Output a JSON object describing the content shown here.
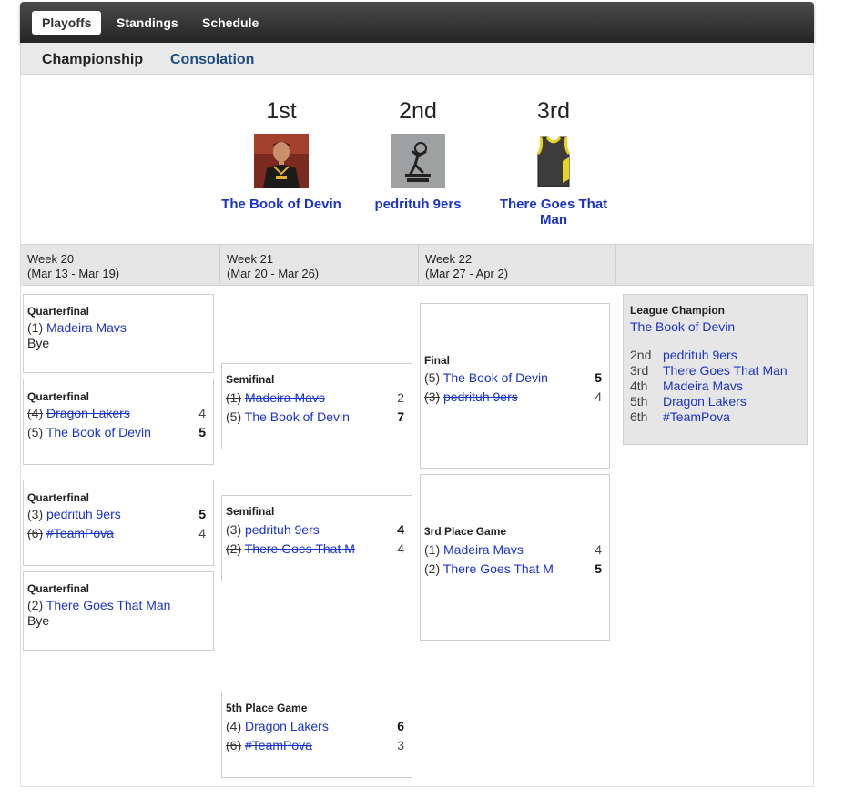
{
  "nav": {
    "tabs": [
      {
        "label": "Playoffs",
        "active": true
      },
      {
        "label": "Standings",
        "active": false
      },
      {
        "label": "Schedule",
        "active": false
      }
    ]
  },
  "subnav": {
    "championship": "Championship",
    "consolation": "Consolation"
  },
  "podium": [
    {
      "place": "1st",
      "team": "The Book of Devin",
      "team_line2": ""
    },
    {
      "place": "2nd",
      "team": "pedrituh 9ers",
      "team_line2": ""
    },
    {
      "place": "3rd",
      "team": "There Goes That",
      "team_line2": "Man"
    }
  ],
  "weeks": [
    {
      "label": "Week 20",
      "range": "(Mar 13 - Mar 19)"
    },
    {
      "label": "Week 21",
      "range": "(Mar 20 - Mar 26)"
    },
    {
      "label": "Week 22",
      "range": "(Mar 27 - Apr 2)"
    },
    {
      "label": "",
      "range": ""
    }
  ],
  "games": {
    "qf1": {
      "title": "Quarterfinal",
      "t1_seed": "(1)",
      "t1": "Madeira Mavs",
      "bye": "Bye"
    },
    "qf2": {
      "title": "Quarterfinal",
      "t1_seed": "(4)",
      "t1": "Dragon Lakers",
      "s1": "4",
      "t2_seed": "(5)",
      "t2": "The Book of Devin",
      "s2": "5"
    },
    "qf3": {
      "title": "Quarterfinal",
      "t1_seed": "(3)",
      "t1": "pedrituh 9ers",
      "s1": "5",
      "t2_seed": "(6)",
      "t2": "#TeamPova",
      "s2": "4"
    },
    "qf4": {
      "title": "Quarterfinal",
      "t1_seed": "(2)",
      "t1": "There Goes That Man",
      "bye": "Bye"
    },
    "sf1": {
      "title": "Semifinal",
      "t1_seed": "(1)",
      "t1": "Madeira Mavs",
      "s1": "2",
      "t2_seed": "(5)",
      "t2": "The Book of Devin",
      "s2": "7"
    },
    "sf2": {
      "title": "Semifinal",
      "t1_seed": "(3)",
      "t1": "pedrituh 9ers",
      "s1": "4",
      "t2_seed": "(2)",
      "t2": "There Goes That M",
      "s2": "4"
    },
    "fifth": {
      "title": "5th Place Game",
      "t1_seed": "(4)",
      "t1": "Dragon Lakers",
      "s1": "6",
      "t2_seed": "(6)",
      "t2": "#TeamPova",
      "s2": "3"
    },
    "final": {
      "title": "Final",
      "t1_seed": "(5)",
      "t1": "The Book of Devin",
      "s1": "5",
      "t2_seed": "(3)",
      "t2": "pedrituh 9ers",
      "s2": "4"
    },
    "third": {
      "title": "3rd Place Game",
      "t1_seed": "(1)",
      "t1": "Madeira Mavs",
      "s1": "4",
      "t2_seed": "(2)",
      "t2": "There Goes That M",
      "s2": "5"
    }
  },
  "champion": {
    "title": "League Champion",
    "name": "The Book of Devin",
    "standings": [
      {
        "place": "2nd",
        "team": "pedrituh 9ers"
      },
      {
        "place": "3rd",
        "team": "There Goes That Man"
      },
      {
        "place": "4th",
        "team": "Madeira Mavs"
      },
      {
        "place": "5th",
        "team": "Dragon Lakers"
      },
      {
        "place": "6th",
        "team": "#TeamPova"
      }
    ]
  }
}
